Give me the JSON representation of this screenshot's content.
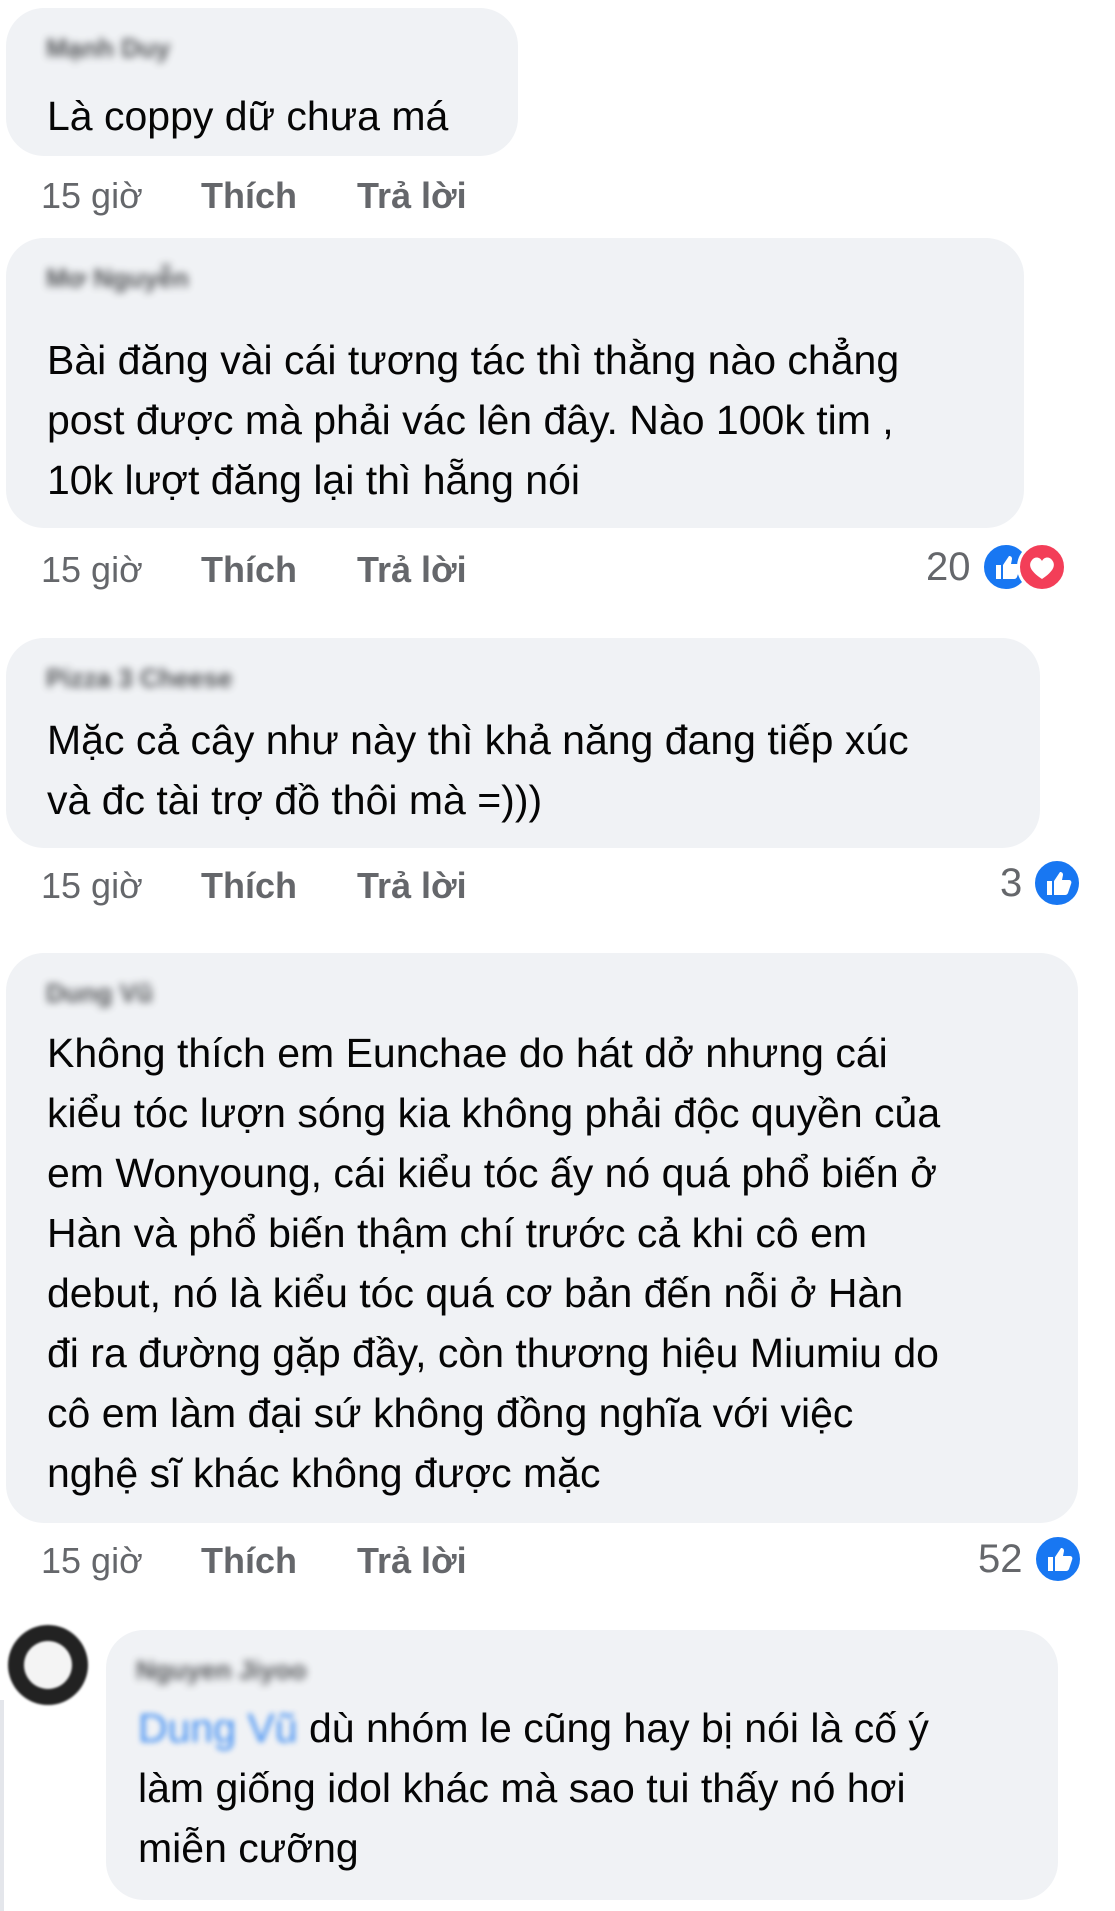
{
  "comments": [
    {
      "author": "Mạnh Duy",
      "lines": [
        "Là coppy dữ chưa má"
      ],
      "time": "15 giờ",
      "like_label": "Thích",
      "reply_label": "Trả lời",
      "reaction_count": ""
    },
    {
      "author": "Mơ Nguyễn",
      "lines": [
        "Bài đăng vài cái tương tác thì thằng nào chẳng",
        "post được mà phải vác lên đây. Nào 100k tim ,",
        "10k lượt đăng lại thì hẵng nói"
      ],
      "time": "15 giờ",
      "like_label": "Thích",
      "reply_label": "Trả lời",
      "reaction_count": "20"
    },
    {
      "author": "Pizza 3 Cheese",
      "lines": [
        "Mặc cả cây như này thì khả năng đang tiếp xúc",
        "và đc tài trợ đồ thôi mà =)))"
      ],
      "time": "15 giờ",
      "like_label": "Thích",
      "reply_label": "Trả lời",
      "reaction_count": "3"
    },
    {
      "author": "Dung Vũ",
      "lines": [
        "Không thích em Eunchae do hát dở nhưng cái",
        "kiểu tóc lượn sóng kia không phải độc quyền của",
        "em Wonyoung, cái kiểu tóc ấy nó quá phổ biến ở",
        "Hàn và phổ biến thậm chí trước cả khi cô em",
        "debut, nó là kiểu tóc quá cơ bản đến nỗi ở Hàn",
        "đi ra đường gặp đầy, còn thương hiệu Miumiu do",
        "cô em làm đại sứ không đồng nghĩa với việc",
        "nghệ sĩ khác không được mặc"
      ],
      "time": "15 giờ",
      "like_label": "Thích",
      "reply_label": "Trả lời",
      "reaction_count": "52"
    }
  ],
  "reply": {
    "author": "Nguyen Jiyoo",
    "mention": "Dung Vũ",
    "lines": [
      " dù nhóm le cũng hay bị nói là cố ý",
      "làm giống idol khác mà sao tui thấy nó hơi",
      "miễn cưỡng"
    ]
  },
  "colors": {
    "bubble": "#f0f2f5",
    "meta": "#65676b",
    "like": "#1877f2",
    "love": "#f33e58"
  }
}
